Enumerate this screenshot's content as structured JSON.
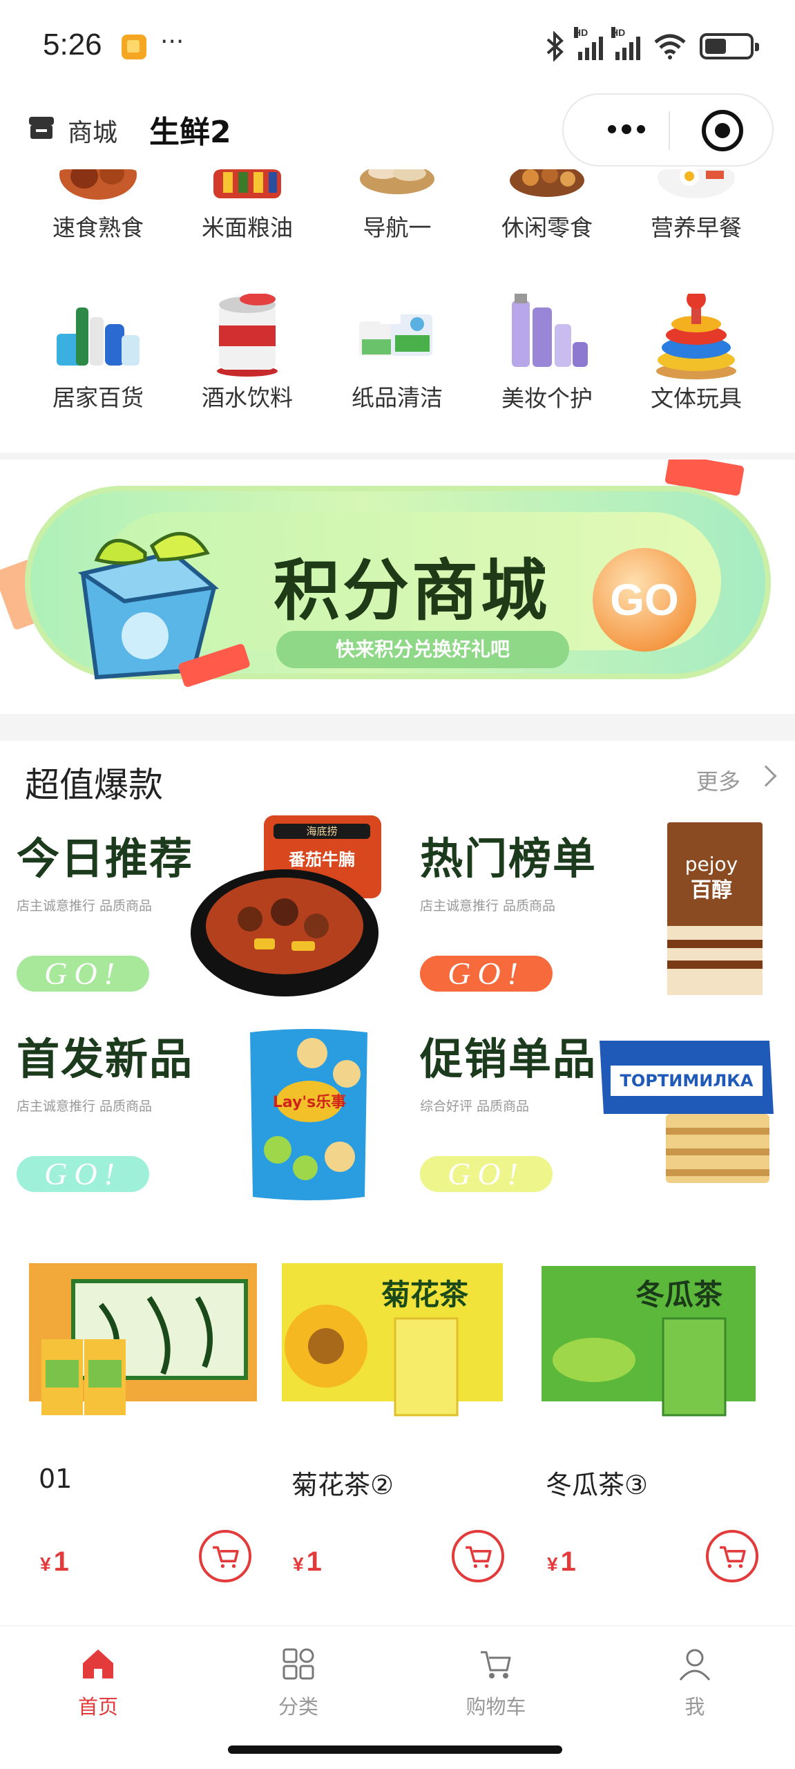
{
  "status_bar": {
    "time": "5:26",
    "dots": "···",
    "signal_hd": "HD"
  },
  "header": {
    "store_label": "商城",
    "title": "生鲜2"
  },
  "categories": [
    {
      "label": "速食熟食",
      "icon": "fried-chicken-icon"
    },
    {
      "label": "米面粮油",
      "icon": "groceries-icon"
    },
    {
      "label": "导航一",
      "icon": "bread-basket-icon"
    },
    {
      "label": "休闲零食",
      "icon": "nuts-icon"
    },
    {
      "label": "营养早餐",
      "icon": "breakfast-plate-icon"
    },
    {
      "label": "居家百货",
      "icon": "household-bottles-icon"
    },
    {
      "label": "酒水饮料",
      "icon": "beer-can-icon"
    },
    {
      "label": "纸品清洁",
      "icon": "tissue-icon"
    },
    {
      "label": "美妆个护",
      "icon": "cosmetics-icon"
    },
    {
      "label": "文体玩具",
      "icon": "stacking-rings-icon"
    }
  ],
  "banner": {
    "title": "积分商城",
    "subtitle": "快来积分兑换好礼吧",
    "go": "GO"
  },
  "hot": {
    "title": "超值爆款",
    "more": "更多",
    "promos": [
      {
        "title": "今日推荐",
        "subtitle": "店主诚意推行 品质商品",
        "go": "GO!",
        "color": "#a8e89a"
      },
      {
        "title": "热门榜单",
        "subtitle": "店主诚意推行 品质商品",
        "go": "GO!",
        "color": "#f76a3c"
      },
      {
        "title": "首发新品",
        "subtitle": "店主诚意推行 品质商品",
        "go": "GO!",
        "color": "#9ef0d8"
      },
      {
        "title": "促销单品",
        "subtitle": "综合好评 品质商品",
        "go": "GO!",
        "color": "#eef58a"
      }
    ],
    "product_labels": {
      "hotpot_pack": "番茄牛腩",
      "hotpot_brand": "海底捞",
      "pejoy_brand": "pejoy",
      "pejoy_cn": "百醇",
      "lays": "Lay's乐事",
      "wafer": "ТОРТИМИЛКА"
    }
  },
  "products": [
    {
      "name": "01",
      "currency": "¥",
      "price": "1"
    },
    {
      "name": "菊花茶②",
      "currency": "¥",
      "price": "1"
    },
    {
      "name": "冬瓜茶③",
      "currency": "¥",
      "price": "1"
    }
  ],
  "tabs": [
    {
      "label": "首页",
      "icon": "home-icon",
      "active": true
    },
    {
      "label": "分类",
      "icon": "grid-icon",
      "active": false
    },
    {
      "label": "购物车",
      "icon": "cart-icon",
      "active": false
    },
    {
      "label": "我",
      "icon": "user-icon",
      "active": false
    }
  ],
  "colors": {
    "accent": "#e33b3b",
    "muted": "#999999"
  }
}
